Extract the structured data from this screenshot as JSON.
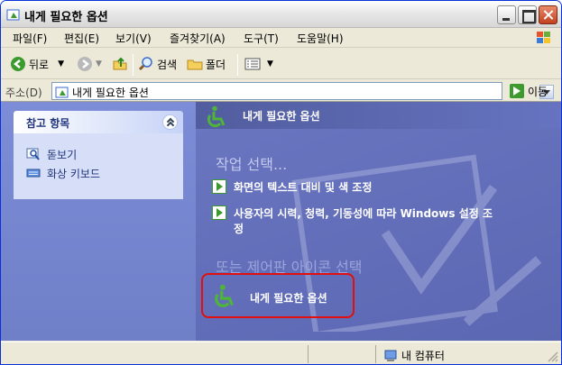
{
  "window": {
    "title": "내게 필요한 옵션"
  },
  "menu": [
    "파일(F)",
    "편집(E)",
    "보기(V)",
    "즐겨찾기(A)",
    "도구(T)",
    "도움말(H)"
  ],
  "toolbar": {
    "back_label": "뒤로",
    "search_label": "검색",
    "folders_label": "폴더"
  },
  "address": {
    "label": "주소(D)",
    "value": "내게 필요한 옵션",
    "go_label": "이동"
  },
  "sidebar": {
    "panel_title": "참고 항목",
    "links": [
      {
        "label": "돋보기",
        "icon": "magnifier-icon"
      },
      {
        "label": "화상 키보드",
        "icon": "keyboard-icon"
      }
    ]
  },
  "main": {
    "header_title": "내게 필요한 옵션",
    "task_heading": "작업 선택...",
    "tasks": [
      {
        "line1": "화면의 텍스트 대비 및 색 조정",
        "line2": ""
      },
      {
        "line1": "사용자의 시력, 청력, 기동성에 따라  Windows 설정 조",
        "line2": "정"
      }
    ],
    "cp_heading": "또는 제어판 아이콘 선택",
    "cp_icons": [
      {
        "label": "내게 필요한 옵션"
      }
    ]
  },
  "status": {
    "zone": "내 컴퓨터"
  },
  "colors": {
    "accent_red": "#e01010",
    "wheelchair_green": "#3c9a2e",
    "pane_blue": "#6a76c0"
  }
}
